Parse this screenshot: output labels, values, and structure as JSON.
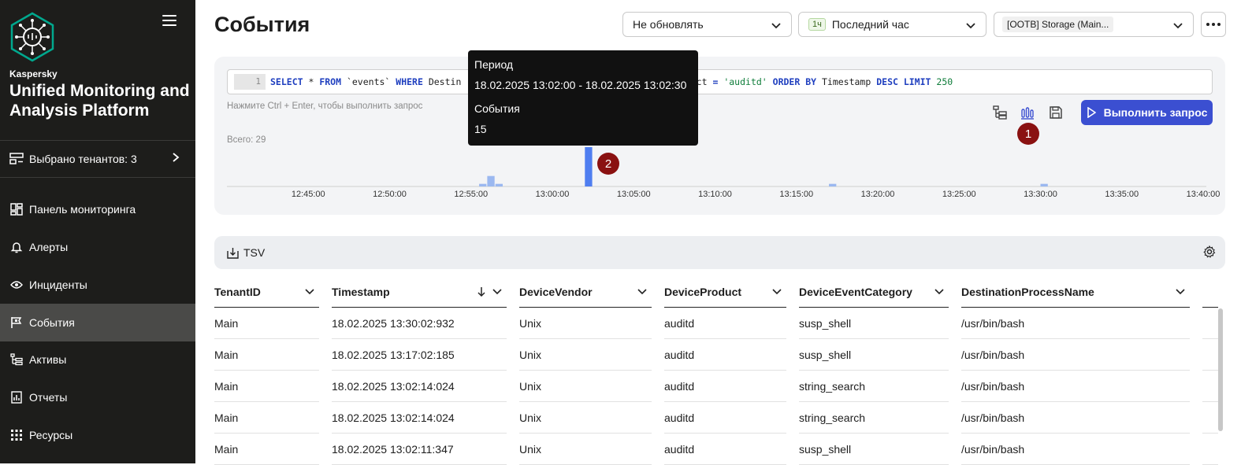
{
  "sidebar": {
    "brand_small": "Kaspersky",
    "brand_big": "Unified Monitoring and Analysis Platform",
    "tenant_label": "Выбрано тенантов: 3",
    "items": [
      {
        "label": "Панель мониторинга",
        "icon": "dashboard-icon"
      },
      {
        "label": "Алерты",
        "icon": "bell-icon"
      },
      {
        "label": "Инциденты",
        "icon": "eye-icon"
      },
      {
        "label": "События",
        "icon": "flag-icon",
        "active": true
      },
      {
        "label": "Активы",
        "icon": "tree-icon"
      },
      {
        "label": "Отчеты",
        "icon": "report-icon"
      },
      {
        "label": "Ресурсы",
        "icon": "grid-icon"
      }
    ]
  },
  "header": {
    "title": "События",
    "refresh_select": "Не обновлять",
    "period_badge": "1ч",
    "period_select": "Последний час",
    "storage_select": "[OOTB] Storage (Main..."
  },
  "query": {
    "line_no": "1",
    "sql_parts": {
      "p1": "SELECT",
      "p2": " * ",
      "p3": "FROM",
      "p4": " `events` ",
      "p5": "WHERE",
      "p6": " Destin",
      "p7": "viceProduct ",
      "p8": "=",
      "p9": " 'auditd' ",
      "p10": "ORDER BY",
      "p11": " Timestamp ",
      "p12": "DESC LIMIT",
      "p13": " 250"
    },
    "hint": "Нажмите Ctrl + Enter, чтобы выполнить запрос",
    "total": "Всего: 29",
    "run_label": "Выполнить запрос"
  },
  "tooltip": {
    "period_label": "Период",
    "period_value": "18.02.2025 13:02:00 - 18.02.2025 13:02:30",
    "events_label": "События",
    "events_value": "15"
  },
  "markers": {
    "m1": "1",
    "m2": "2"
  },
  "chart_data": {
    "type": "bar",
    "title": "",
    "x_ticks": [
      "12:45:00",
      "12:50:00",
      "12:55:00",
      "13:00:00",
      "13:05:00",
      "13:10:00",
      "13:15:00",
      "13:20:00",
      "13:25:00",
      "13:30:00",
      "13:35:00",
      "13:40:00"
    ],
    "bars": [
      {
        "time": "12:55:30",
        "value": 1
      },
      {
        "time": "12:56:00",
        "value": 4
      },
      {
        "time": "12:56:30",
        "value": 1
      },
      {
        "time": "13:02:00",
        "value": 15
      },
      {
        "time": "13:17:00",
        "value": 1
      },
      {
        "time": "13:30:00",
        "value": 1
      }
    ],
    "highlighted": "13:02:00",
    "bar_color": "#9bb8f0",
    "bar_highlight_color": "#4f7ef0"
  },
  "toolbar": {
    "tsv_label": "TSV"
  },
  "table": {
    "columns": [
      "TenantID",
      "Timestamp",
      "DeviceVendor",
      "DeviceProduct",
      "DeviceEventCategory",
      "DestinationProcessName"
    ],
    "rows": [
      [
        "Main",
        "18.02.2025 13:30:02:932",
        "Unix",
        "auditd",
        "susp_shell",
        "/usr/bin/bash"
      ],
      [
        "Main",
        "18.02.2025 13:17:02:185",
        "Unix",
        "auditd",
        "susp_shell",
        "/usr/bin/bash"
      ],
      [
        "Main",
        "18.02.2025 13:02:14:024",
        "Unix",
        "auditd",
        "string_search",
        "/usr/bin/bash"
      ],
      [
        "Main",
        "18.02.2025 13:02:14:024",
        "Unix",
        "auditd",
        "string_search",
        "/usr/bin/bash"
      ],
      [
        "Main",
        "18.02.2025 13:02:11:347",
        "Unix",
        "auditd",
        "susp_shell",
        "/usr/bin/bash"
      ]
    ]
  }
}
